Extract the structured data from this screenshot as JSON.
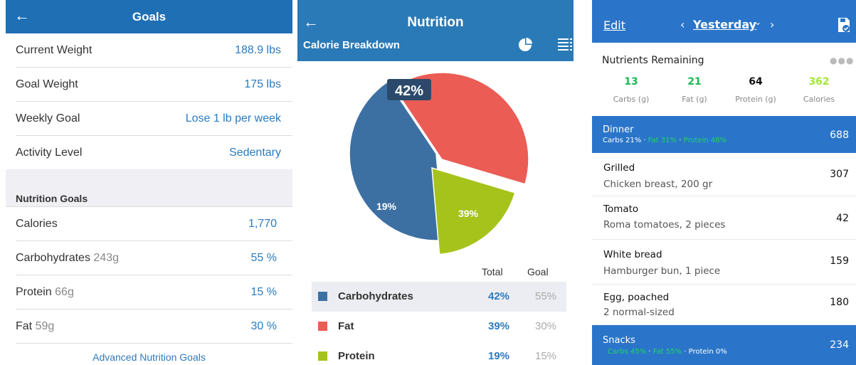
{
  "goals_screen": {
    "header": {
      "back_icon": "arrow-left-icon",
      "title": "Goals"
    },
    "rows": [
      {
        "label": "Current Weight",
        "value": "188.9 lbs"
      },
      {
        "label": "Goal Weight",
        "value": "175 lbs"
      },
      {
        "label": "Weekly Goal",
        "value": "Lose 1 lb per week"
      },
      {
        "label": "Activity Level",
        "value": "Sedentary"
      }
    ],
    "nutrition_section_title": "Nutrition Goals",
    "nutrition_rows": [
      {
        "label": "Calories",
        "sub": "",
        "value": "1,770"
      },
      {
        "label": "Carbohydrates",
        "sub": "243g",
        "value": "55 %"
      },
      {
        "label": "Protein",
        "sub": "66g",
        "value": "15 %"
      },
      {
        "label": "Fat",
        "sub": "59g",
        "value": "30 %"
      }
    ],
    "advanced_link": "Advanced Nutrition Goals"
  },
  "nutrition_screen": {
    "header": {
      "back_icon": "arrow-left-icon",
      "title": "Nutrition",
      "subtitle": "Calorie Breakdown",
      "pie_icon": "pie-chart-icon",
      "list_icon": "list-icon"
    },
    "colors": {
      "carbohydrates": "#3d70a2",
      "fat": "#eb5c55",
      "protein": "#a6c31b"
    },
    "legend_headers": {
      "total": "Total",
      "goal": "Goal"
    },
    "legend": [
      {
        "name": "Carbohydrates",
        "total": "42%",
        "goal": "55%"
      },
      {
        "name": "Fat",
        "total": "39%",
        "goal": "30%"
      },
      {
        "name": "Protein",
        "total": "19%",
        "goal": "15%"
      }
    ]
  },
  "chart_data": {
    "type": "pie",
    "title": "",
    "labels": [
      "Carbohydrates",
      "Fat",
      "Protein"
    ],
    "values": [
      42,
      39,
      19
    ],
    "value_labels": [
      "42%",
      "39%",
      "19%"
    ],
    "colors": [
      "#3d70a2",
      "#eb5c55",
      "#a6c31b"
    ],
    "legend": "bottom"
  },
  "diary_screen": {
    "header": {
      "edit": "Edit",
      "prev_icon": "chevron-left-icon",
      "date": "Yesterday",
      "date_dropdown_icon": "chevron-down-icon",
      "next_icon": "chevron-right-icon",
      "save_icon": "save-check-icon"
    },
    "remaining_title": "Nutrients Remaining",
    "more_icon": "more-dots-icon",
    "macros": [
      {
        "value": "13",
        "unit": "Carbs (g)",
        "color": "#1db954"
      },
      {
        "value": "21",
        "unit": "Fat (g)",
        "color": "#1db954"
      },
      {
        "value": "64",
        "unit": "Protein (g)",
        "color": "#111111"
      },
      {
        "value": "362",
        "unit": "Calories",
        "color": "#a3e635"
      }
    ],
    "dinner": {
      "name": "Dinner",
      "carbs_label": "Carbs",
      "carbs_pct": "21%",
      "fat": "Fat 31%",
      "protein": "Protein 48%",
      "separator": "·",
      "calories": "688"
    },
    "foods": [
      {
        "name": "Grilled",
        "desc": "Chicken breast, 200 gr",
        "calories": "307"
      },
      {
        "name": "Tomato",
        "desc": "Roma tomatoes, 2 pieces",
        "calories": "42"
      },
      {
        "name": "White bread",
        "desc": "Hamburger bun, 1 piece",
        "calories": "159"
      },
      {
        "name": "Egg, poached",
        "desc": "2 normal-sized",
        "calories": "180"
      }
    ],
    "snacks": {
      "name": "Snacks",
      "carbs": "Carbs 45%",
      "fat": "Fat 55%",
      "protein": "Protein 0%",
      "separator": "·",
      "calories": "234"
    }
  }
}
